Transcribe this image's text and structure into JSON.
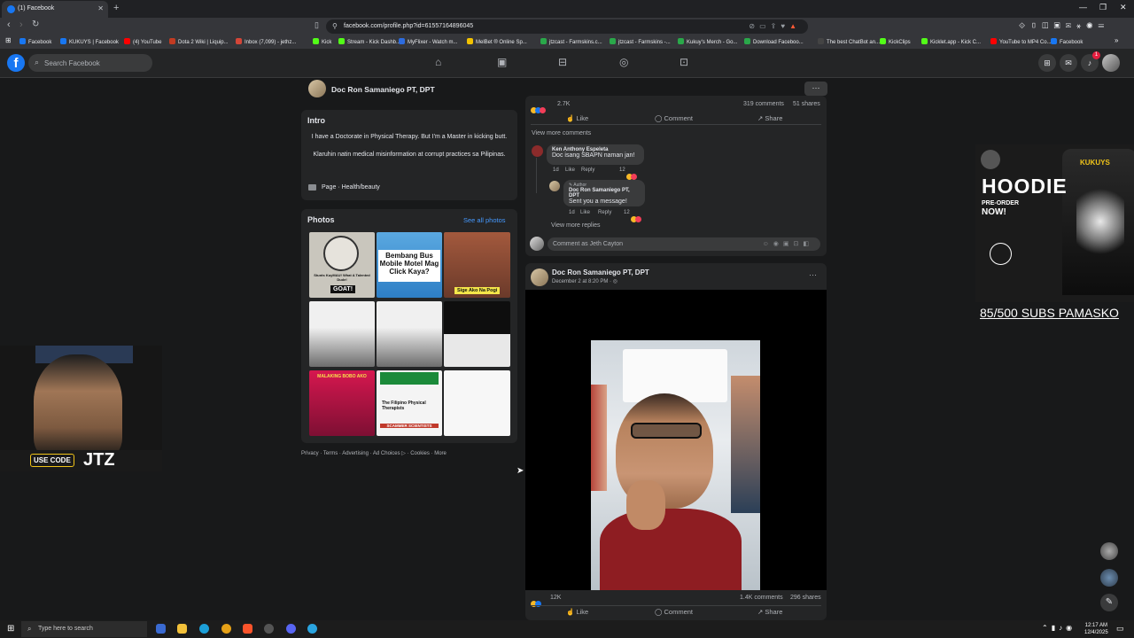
{
  "browser": {
    "tab_title": "(1) Facebook",
    "new_tab": "+",
    "url": "facebook.com/profile.php?id=61557164896045",
    "bookmarks": [
      "Facebook",
      "KUKUYS | Facebook",
      "(4) YouTube",
      "Dota 2 Wiki | Liquip...",
      "Inbox (7,099) - jethz...",
      "Kick",
      "Stream - Kick Dashb...",
      "MyFlixer - Watch m...",
      "MelBet ® Online Sp...",
      "jtzcast - Farmskins.c...",
      "jtzcast - Farmskins -...",
      "Kukuy's Merch - Go...",
      "Download Faceboo...",
      "The best ChatBot an...",
      "KickClips",
      "Kicklet.app - Kick C...",
      "YouTube to MP4 Co...",
      "Facebook"
    ],
    "bookmark_colors": [
      "#1877f2",
      "#1877f2",
      "#ff0000",
      "#c23b22",
      "#d44638",
      "#53fc18",
      "#53fc18",
      "#2d6cdf",
      "#f2c200",
      "#2aa84a",
      "#2aa84a",
      "#2aa84a",
      "#2aa84a",
      "#444444",
      "#53fc18",
      "#53fc18",
      "#ff0000",
      "#1877f2"
    ]
  },
  "facebook": {
    "search_placeholder": "Search Facebook",
    "notification_count": "1",
    "profile_name": "Doc Ron Samaniego PT, DPT",
    "intro": {
      "title": "Intro",
      "bio_line1": "I have a Doctorate in Physical Therapy. But I'm a Master in kicking butt.",
      "bio_line2": "Klaruhin natin medical misinformation at corrupt practices sa Pilipinas.",
      "category": "Page · Health/beauty"
    },
    "photos": {
      "title": "Photos",
      "see_all": "See all photos",
      "p1_caption": "Stunts KuyMAU! What A Talented Dude!",
      "p1_tag": "GOAT!",
      "p2_text": "Bembang Bus Mobile Motel Mag Click Kaya?",
      "p3_tag": "Sige Ako Na Pogi",
      "p7_text": "MALAKING BOBO AKO",
      "p8_text": "The Filipino Physical Therapists",
      "p8_tag": "SCAMMER SCIENTISTS"
    },
    "footer": "Privacy · Terms · Advertising · Ad Choices ▷ · Cookies · More",
    "post1": {
      "reactions": "2.7K",
      "comments": "319 comments",
      "shares": "51 shares",
      "like": "Like",
      "comment": "Comment",
      "share": "Share",
      "view_more_comments": "View more comments",
      "c1_name": "Ken Anthony Espeleta",
      "c1_text": "Doc isang SBAPN naman jan!",
      "c1_time": "1d",
      "c1_like": "Like",
      "c1_reply": "Reply",
      "c1_count": "12",
      "c2_badge": "✎ Author",
      "c2_name": "Doc Ron Samaniego PT, DPT",
      "c2_text": "Sent you a message!",
      "c2_time": "1d",
      "c2_like": "Like",
      "c2_reply": "Reply",
      "c2_count": "12",
      "view_more_replies": "View more replies",
      "comment_as": "Comment as Jeth Cayton"
    },
    "post2": {
      "author": "Doc Ron Samaniego PT, DPT",
      "date": "December 2 at 8:20 PM · ◎",
      "reactions": "12K",
      "comments": "1.4K comments",
      "shares": "296 shares",
      "like": "Like",
      "comment": "Comment",
      "share": "Share"
    }
  },
  "overlay": {
    "ad_title": "HOODIE",
    "ad_sub1": "PRE-ORDER",
    "ad_sub2": "NOW!",
    "ad_brand": "KUKUYS",
    "subs": "85/500 SUBS PAMASKO",
    "code_label": "USE CODE",
    "code_value": "JTZ"
  },
  "taskbar": {
    "search_placeholder": "Type here to search",
    "time": "12:17 AM",
    "date": "12/4/2025"
  }
}
